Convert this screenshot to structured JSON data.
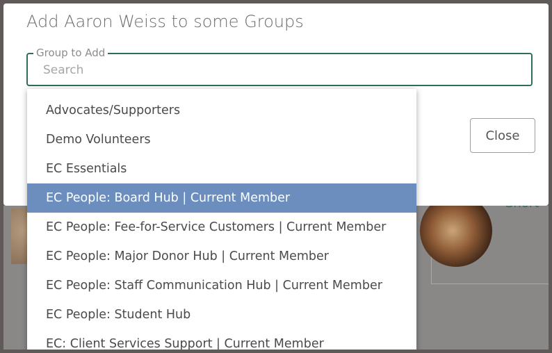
{
  "background": {
    "peek_text": "Short"
  },
  "modal": {
    "title": "Add Aaron Weiss to some Groups",
    "field_label": "Group to Add",
    "search_placeholder": "Search",
    "search_value": "",
    "close_label": "Close"
  },
  "dropdown": {
    "selected_index": 3,
    "options": [
      "Advocates/Supporters",
      "Demo Volunteers",
      "EC Essentials",
      "EC People: Board Hub | Current Member",
      "EC People: Fee-for-Service Customers | Current Member",
      "EC People: Major Donor Hub | Current Member",
      "EC People: Staff Communication Hub | Current Member",
      "EC People: Student Hub",
      "EC: Client Services Support | Current Member"
    ]
  },
  "colors": {
    "accent": "#2f6e55",
    "selected": "#6b8ebf"
  }
}
